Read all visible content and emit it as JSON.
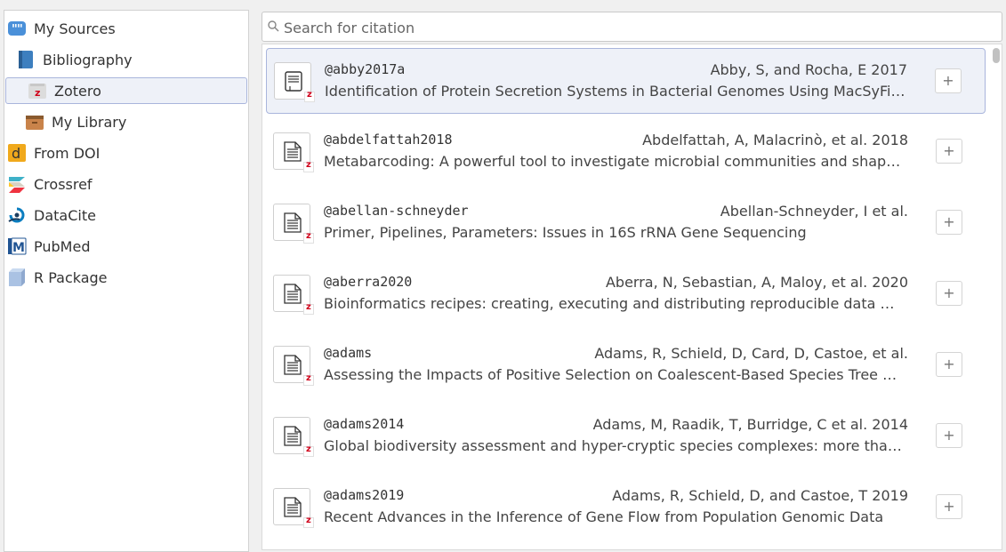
{
  "sources": [
    {
      "label": "My Sources",
      "icon": "quote-icon",
      "indent": 0,
      "selected": false
    },
    {
      "label": "Bibliography",
      "icon": "book-icon",
      "indent": 1,
      "selected": false
    },
    {
      "label": "Zotero",
      "icon": "zotero-icon",
      "indent": 1,
      "selected": true
    },
    {
      "label": "My Library",
      "icon": "library-box-icon",
      "indent": 2,
      "selected": false
    },
    {
      "label": "From DOI",
      "icon": "doi-icon",
      "indent": 0,
      "selected": false
    },
    {
      "label": "Crossref",
      "icon": "crossref-icon",
      "indent": 0,
      "selected": false
    },
    {
      "label": "DataCite",
      "icon": "datacite-icon",
      "indent": 0,
      "selected": false
    },
    {
      "label": "PubMed",
      "icon": "pubmed-icon",
      "indent": 0,
      "selected": false
    },
    {
      "label": "R Package",
      "icon": "r-package-icon",
      "indent": 0,
      "selected": false
    }
  ],
  "search": {
    "placeholder": "Search for citation",
    "value": ""
  },
  "citations": [
    {
      "key": "@abby2017a",
      "authors": "Abby, S, and Rocha, E 2017",
      "title": "Identification of Protein Secretion Systems in Bacterial Genomes Using MacSyFi…",
      "selected": true,
      "add_label": "+"
    },
    {
      "key": "@abdelfattah2018",
      "authors": "Abdelfattah, A, Malacrinò, et al. 2018",
      "title": "Metabarcoding: A powerful tool to investigate microbial communities and shap…",
      "selected": false,
      "add_label": "+"
    },
    {
      "key": "@abellan-schneyder",
      "authors": "Abellan-Schneyder, I et al.",
      "title": "Primer, Pipelines, Parameters: Issues in 16S rRNA Gene Sequencing",
      "selected": false,
      "add_label": "+"
    },
    {
      "key": "@aberra2020",
      "authors": "Aberra, N, Sebastian, A, Maloy, et al. 2020",
      "title": "Bioinformatics recipes: creating, executing and distributing reproducible data …",
      "selected": false,
      "add_label": "+"
    },
    {
      "key": "@adams",
      "authors": "Adams, R, Schield, D, Card, D, Castoe, et al.",
      "title": "Assessing the Impacts of Positive Selection on Coalescent-Based Species Tree …",
      "selected": false,
      "add_label": "+"
    },
    {
      "key": "@adams2014",
      "authors": "Adams, M, Raadik, T, Burridge, C et al. 2014",
      "title": "Global biodiversity assessment and hyper-cryptic species complexes: more tha…",
      "selected": false,
      "add_label": "+"
    },
    {
      "key": "@adams2019",
      "authors": "Adams, R, Schield, D, and Castoe, T 2019",
      "title": "Recent Advances in the Inference of Gene Flow from Population Genomic Data",
      "selected": false,
      "add_label": "+"
    }
  ],
  "colors": {
    "accent": "#a9b5dc",
    "selected_bg": "#eef1f8",
    "zotero_red": "#d0021b"
  }
}
